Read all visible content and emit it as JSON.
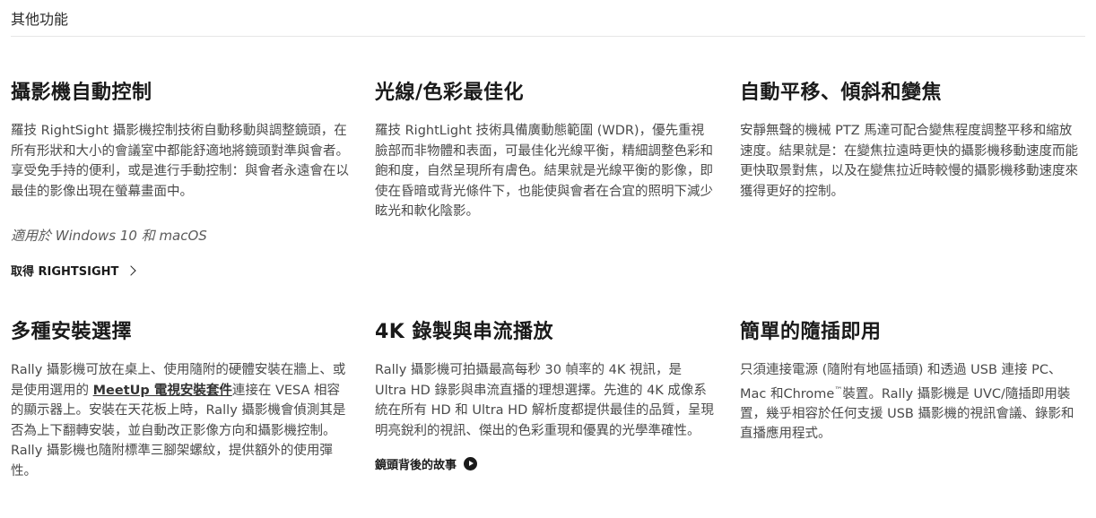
{
  "section": {
    "title": "其他功能"
  },
  "features": [
    {
      "heading": "攝影機自動控制",
      "body": "羅技 RightSight 攝影機控制技術自動移動與調整鏡頭，在所有形狀和大小的會議室中都能舒適地將鏡頭對準與會者。享受免手持的便利，或是進行手動控制：與會者永遠會在以最佳的影像出現在螢幕畫面中。",
      "note": "適用於 Windows 10 和 macOS",
      "cta": "取得 RIGHTSIGHT"
    },
    {
      "heading": "光線/色彩最佳化",
      "body": "羅技 RightLight 技術具備廣動態範圍 (WDR)，優先重視臉部而非物體和表面，可最佳化光線平衡，精細調整色彩和飽和度，自然呈現所有膚色。結果就是光線平衡的影像，即使在昏暗或背光條件下，也能使與會者在合宜的照明下減少眩光和軟化陰影。"
    },
    {
      "heading": "自動平移、傾斜和變焦",
      "body": "安靜無聲的機械 PTZ 馬達可配合變焦程度調整平移和縮放速度。結果就是：在變焦拉遠時更快的攝影機移動速度而能更快取景對焦，以及在變焦拉近時較慢的攝影機移動速度來獲得更好的控制。"
    },
    {
      "heading": "多種安裝選擇",
      "body_before": "Rally 攝影機可放在桌上、使用隨附的硬體安裝在牆上、或是使用選用的 ",
      "link": "MeetUp 電視安裝套件",
      "body_after": "連接在 VESA 相容的顯示器上。安裝在天花板上時，Rally 攝影機會偵測其是否為上下翻轉安裝，並自動改正影像方向和攝影機控制。Rally 攝影機也隨附標準三腳架螺紋，提供額外的使用彈性。"
    },
    {
      "heading": "4K 錄製與串流播放",
      "body": "Rally 攝影機可拍攝最高每秒 30 幀率的 4K 視訊，是 Ultra HD 錄影與串流直播的理想選擇。先進的 4K 成像系統在所有 HD 和 Ultra HD 解析度都提供最佳的品質，呈現明亮銳利的視訊、傑出的色彩重現和優異的光學準確性。",
      "cta": "鏡頭背後的故事"
    },
    {
      "heading": "簡單的隨插即用",
      "body_before": "只須連接電源 (隨附有地區插頭) 和透過 USB 連接 PC、Mac 和Chrome",
      "tm": "™",
      "body_after": "裝置。Rally 攝影機是 UVC/隨插即用裝置，幾乎相容於任何支援 USB 攝影機的視訊會議、錄影和直播應用程式。"
    }
  ]
}
